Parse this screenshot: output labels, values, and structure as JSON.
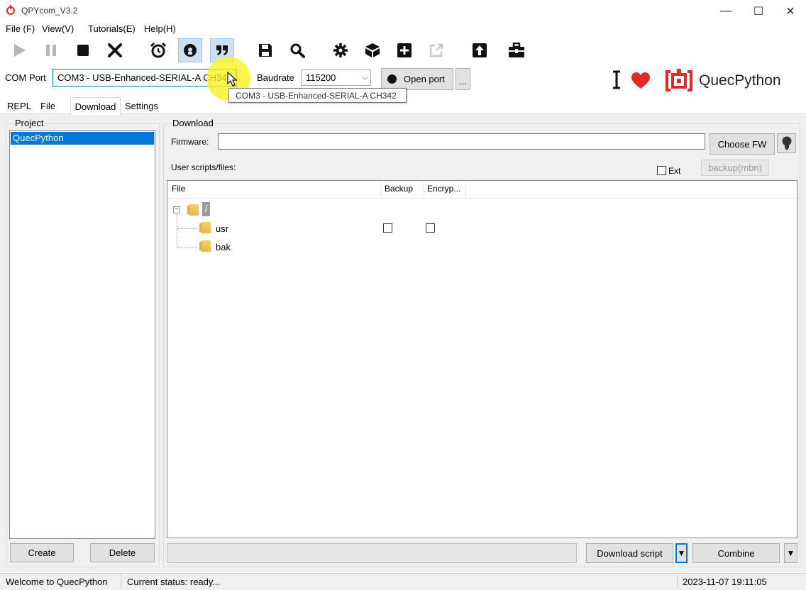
{
  "window": {
    "title": "QPYcom_V3.2",
    "minimize": "—",
    "maximize": "☐",
    "close": "✕"
  },
  "menu": [
    "File (F)",
    "View(V)",
    "Tutorials(E)",
    "Help(H)"
  ],
  "toolbar": {
    "icons": [
      "play-icon",
      "pause-icon",
      "stop-icon",
      "close-x-icon",
      "alarm-clock-icon",
      "replay-icon",
      "quote-icon",
      "save-icon",
      "search-icon",
      "gear-icon",
      "cube-icon",
      "add-icon",
      "external-link-icon",
      "upload-icon",
      "toolbox-icon"
    ]
  },
  "connection": {
    "com_label": "COM Port",
    "com_value": "COM3 - USB-Enhanced-SERIAL-A CH342",
    "baud_label": "Baudrate",
    "baud_value": "115200",
    "open_label": "Open port",
    "more_label": "..."
  },
  "brand": {
    "text": "QuecPython",
    "accent": "#e02a2a"
  },
  "tooltip": "COM3 - USB-Enhanced-SERIAL-A CH342",
  "tabs": [
    "REPL",
    "File",
    "Download",
    "Settings"
  ],
  "project": {
    "title": "Project",
    "items": [
      "QuecPython"
    ],
    "create_label": "Create",
    "delete_label": "Delete"
  },
  "download": {
    "title": "Download",
    "firmware_label": "Firmware:",
    "firmware_value": "",
    "choose_fw_label": "Choose FW",
    "user_scripts_label": "User scripts/files:",
    "ext_label": "Ext",
    "backup_mbn_label": "backup(mbn)",
    "columns": [
      "File",
      "Backup",
      "Encryp..."
    ],
    "tree": {
      "root": "/",
      "children": [
        "usr",
        "bak"
      ]
    },
    "download_script_label": "Download script",
    "combine_label": "Combine",
    "dropdown_glyph": "▼"
  },
  "status": {
    "welcome": "Welcome to QuecPython",
    "current": "Current status: ready...",
    "timestamp": "2023-11-07 19:11:05"
  }
}
